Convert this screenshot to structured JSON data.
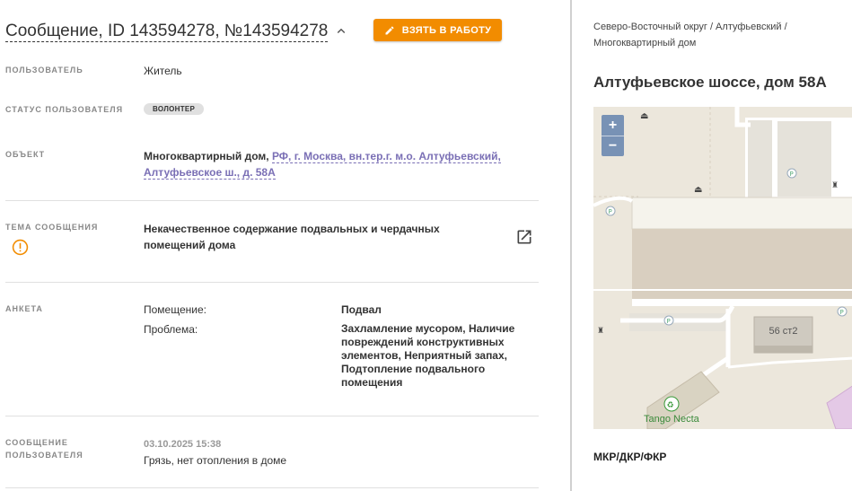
{
  "header": {
    "title": "Сообщение, ID 143594278, №143594278",
    "take_button_label": "ВЗЯТЬ В РАБОТУ"
  },
  "fields": {
    "user_label": "ПОЛЬЗОВАТЕЛЬ",
    "user_value": "Житель",
    "user_status_label": "СТАТУС ПОЛЬЗОВАТЕЛЯ",
    "user_status_value": "ВОЛОНТЕР",
    "object_label": "ОБЪЕКТ",
    "object_type": "Многоквартирный дом,",
    "object_address_line1": "РФ, г. Москва, вн.тер.г. м.о. Алтуфьевский,",
    "object_address_line2": "Алтуфьевское ш., д. 58А",
    "topic_label": "ТЕМА СООБЩЕНИЯ",
    "topic_line1": "Некачественное содержание подвальных и чердачных",
    "topic_line2": "помещений дома",
    "survey_label": "АНКЕТА",
    "survey_rows": [
      {
        "key": "Помещение:",
        "value": [
          "Подвал"
        ]
      },
      {
        "key": "Проблема:",
        "value": [
          "Захламление мусором, Наличие",
          "повреждений конструктивных",
          "элементов, Неприятный запах,",
          "Подтопление подвального",
          "помещения"
        ]
      }
    ],
    "message_label_line1": "СООБЩЕНИЕ",
    "message_label_line2": "ПОЛЬЗОВАТЕЛЯ",
    "message_date": "03.10.2025 15:38",
    "message_text": "Грязь, нет отопления в доме"
  },
  "side": {
    "breadcrumb_line1": "Северо-Восточный округ / Алтуфьевский /",
    "breadcrumb_line2": "Многоквартирный дом",
    "address": "Алтуфьевское шоссе, дом 58А",
    "zoom_in": "+",
    "zoom_out": "−",
    "map_building_label": "56 ст2",
    "map_poi_label": "Tango Necta",
    "footer_label": "МКР/ДКР/ФКР"
  },
  "colors": {
    "accent": "#f28c00",
    "link": "#7a6fb5",
    "warning": "#f28c00"
  },
  "icons": {
    "chevron": "chevron-up-icon",
    "pencil": "pencil-icon",
    "warning": "warning-circle-icon",
    "external": "external-link-icon"
  }
}
